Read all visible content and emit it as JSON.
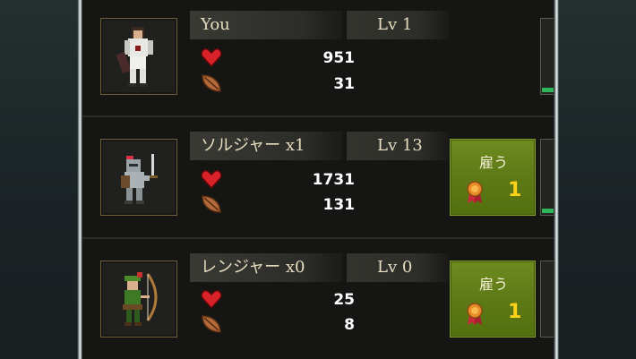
{
  "units": [
    {
      "name": "You",
      "level": "Lv 1",
      "hp": "951",
      "attack": "31",
      "portrait": "warrior-sprite",
      "has_recruit": false,
      "has_stub_bar": true
    },
    {
      "name": "ソルジャー x1",
      "level": "Lv 13",
      "hp": "1731",
      "attack": "131",
      "portrait": "soldier-sprite",
      "has_recruit": true,
      "recruit_label": "雇う",
      "recruit_count": "1",
      "has_stub_bar": true
    },
    {
      "name": "レンジャー x0",
      "level": "Lv 0",
      "hp": "25",
      "attack": "8",
      "portrait": "ranger-sprite",
      "has_recruit": true,
      "recruit_label": "雇う",
      "recruit_count": "1",
      "has_stub_bar": false
    }
  ],
  "icons": {
    "hp": "heart-icon",
    "attack": "attack-leaf-icon",
    "cost": "medal-icon"
  },
  "colors": {
    "recruit_button": "#5e7a16",
    "cost_text": "#ffd21a",
    "heart": "#d8222a",
    "stub_bar": "#2fb55a"
  }
}
